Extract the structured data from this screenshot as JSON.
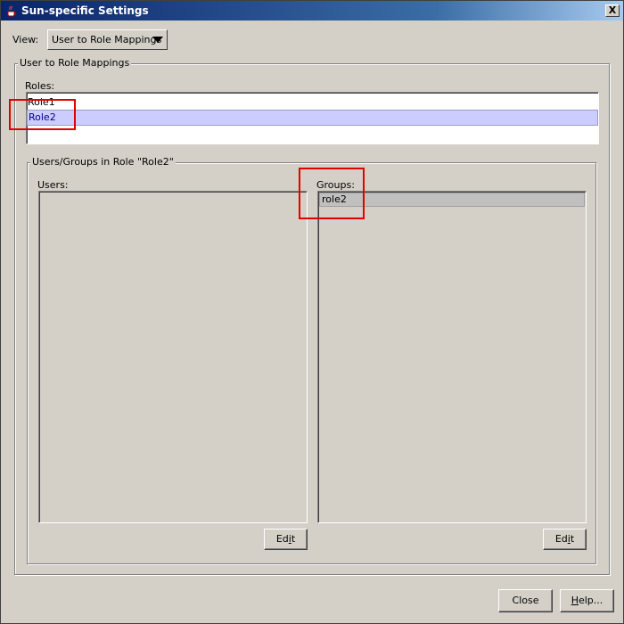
{
  "window": {
    "title": "Sun-specific Settings",
    "close_glyph": "X",
    "icon": "java-coffee-cup-icon"
  },
  "view": {
    "label": "View:",
    "selected": "User to Role Mappings"
  },
  "mapping_panel": {
    "title": "User to Role Mappings",
    "roles_label": "Roles:",
    "roles": [
      {
        "label": "Role1",
        "selected": false
      },
      {
        "label": "Role2",
        "selected": true
      }
    ]
  },
  "members_panel": {
    "title": "Users/Groups in Role \"Role2\"",
    "users_label": "Users:",
    "users": [],
    "groups_label": "Groups:",
    "groups": [
      "role2"
    ],
    "users_edit": {
      "pre": "Ed",
      "mnemonic": "i",
      "post": "t"
    },
    "groups_edit": {
      "pre": "Ed",
      "mnemonic": "i",
      "post": "t"
    }
  },
  "footer": {
    "close_label": "Close",
    "help": {
      "pre": "",
      "mnemonic": "H",
      "post": "elp..."
    }
  },
  "colors": {
    "titlebar": "#0a246a",
    "selection": "#ccccff",
    "annotation": "#e00000",
    "background": "#d4d0c8"
  }
}
